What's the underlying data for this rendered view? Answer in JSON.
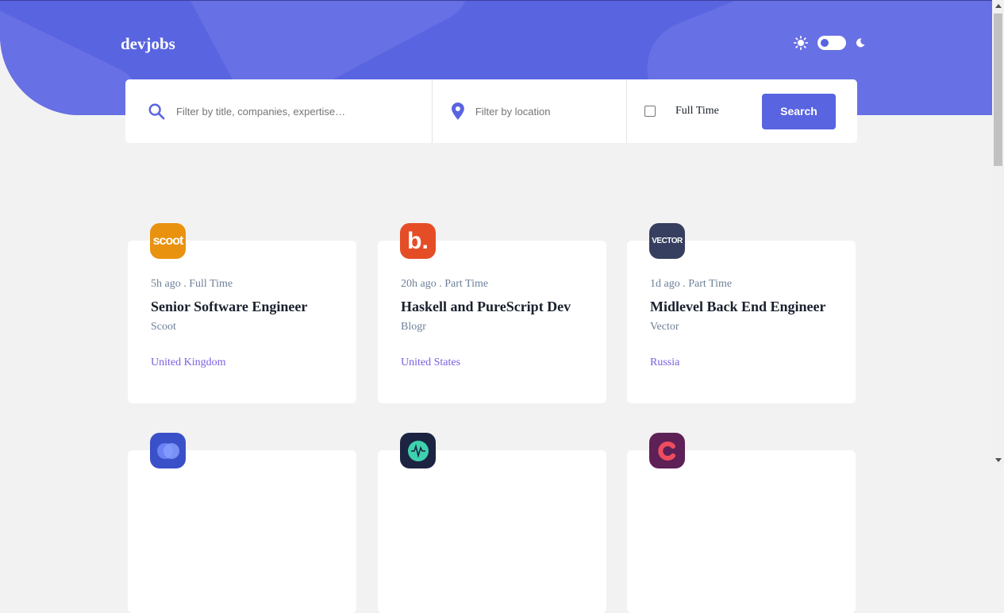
{
  "header": {
    "logo": "devjobs",
    "brand_color": "#5964e0",
    "sun_icon": "sun-icon",
    "moon_icon": "moon-icon"
  },
  "search": {
    "title_placeholder": "Filter by title, companies, expertise…",
    "location_placeholder": "Filter by location",
    "fulltime_label": "Full Time",
    "fulltime_checked": false,
    "button_label": "Search"
  },
  "jobs": [
    {
      "logo_text": "scoot",
      "logo_color": "#e99210",
      "posted": "5h ago",
      "contract": "Full Time",
      "title": "Senior Software Engineer",
      "company": "Scoot",
      "location": "United Kingdom"
    },
    {
      "logo_text": "b.",
      "logo_color": "#e54d26",
      "posted": "20h ago",
      "contract": "Part Time",
      "title": "Haskell and PureScript Dev",
      "company": "Blogr",
      "location": "United States"
    },
    {
      "logo_text": "VECTOR",
      "logo_color": "#363f5f",
      "posted": "1d ago",
      "contract": "Part Time",
      "title": "Midlevel Back End Engineer",
      "company": "Vector",
      "location": "Russia"
    },
    {
      "logo_color": "#3a50c9"
    },
    {
      "logo_color": "#1c2442"
    },
    {
      "logo_color": "#5d2057"
    }
  ]
}
